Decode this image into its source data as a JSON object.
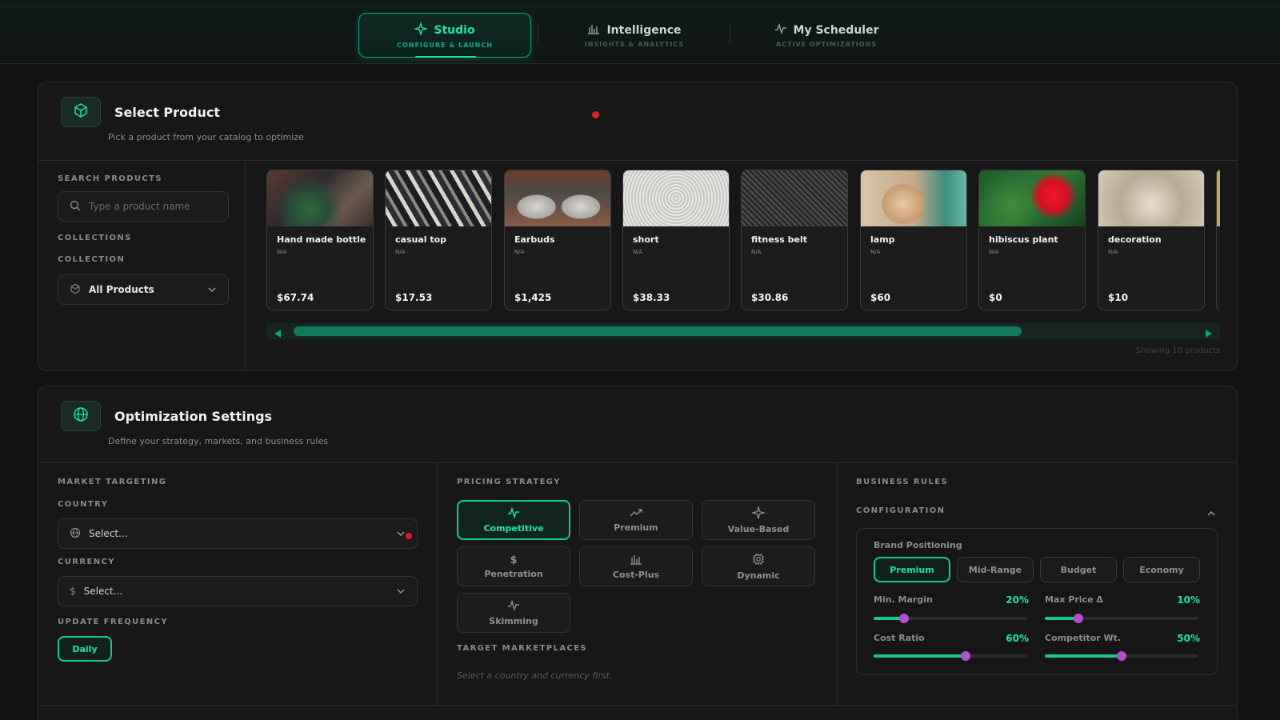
{
  "nav": {
    "tabs": [
      {
        "label": "Studio",
        "sub": "CONFIGURE & LAUNCH"
      },
      {
        "label": "Intelligence",
        "sub": "INSIGHTS & ANALYTICS"
      },
      {
        "label": "My Scheduler",
        "sub": "ACTIVE OPTIMIZATIONS"
      }
    ]
  },
  "select_product": {
    "title": "Select Product",
    "subtitle": "Pick a product from your catalog to optimize",
    "search_label": "SEARCH PRODUCTS",
    "search_placeholder": "Type a product name",
    "collections_label": "COLLECTIONS",
    "collection_label": "COLLECTION",
    "collection_value": "All Products",
    "products": [
      {
        "name": "Hand made bottle",
        "meta": "N/A",
        "price": "$67.74"
      },
      {
        "name": "casual top",
        "meta": "N/A",
        "price": "$17.53"
      },
      {
        "name": "Earbuds",
        "meta": "N/A",
        "price": "$1,425"
      },
      {
        "name": "short",
        "meta": "N/A",
        "price": "$38.33"
      },
      {
        "name": "fitness belt",
        "meta": "N/A",
        "price": "$30.86"
      },
      {
        "name": "lamp",
        "meta": "N/A",
        "price": "$60"
      },
      {
        "name": "hibiscus plant",
        "meta": "N/A",
        "price": "$0"
      },
      {
        "name": "decoration",
        "meta": "N/A",
        "price": "$10"
      }
    ],
    "showing": "Showing 10 products"
  },
  "optimization": {
    "title": "Optimization Settings",
    "subtitle": "Define your strategy, markets, and business rules",
    "market_label": "MARKET TARGETING",
    "country_label": "COUNTRY",
    "country_placeholder": "Select...",
    "currency_label": "CURRENCY",
    "currency_placeholder": "Select...",
    "frequency_label": "UPDATE FREQUENCY",
    "frequency_value": "Daily",
    "pricing_label": "PRICING STRATEGY",
    "strategies": [
      "Competitive",
      "Premium",
      "Value-Based",
      "Penetration",
      "Cost-Plus",
      "Dynamic",
      "Skimming"
    ],
    "marketplaces_label": "TARGET MARKETPLACES",
    "marketplaces_hint": "Select a country and currency first.",
    "business_label": "BUSINESS RULES",
    "config_label": "CONFIGURATION",
    "brand_label": "Brand Positioning",
    "brand_options": [
      "Premium",
      "Mid-Range",
      "Budget",
      "Economy"
    ],
    "sliders": [
      {
        "label": "Min. Margin",
        "value": "20%",
        "fraction": 0.2
      },
      {
        "label": "Max Price Δ",
        "value": "10%",
        "fraction": 0.22
      },
      {
        "label": "Cost Ratio",
        "value": "60%",
        "fraction": 0.6
      },
      {
        "label": "Competitor Wt.",
        "value": "50%",
        "fraction": 0.5
      }
    ]
  },
  "colors": {
    "accent": "#1fe3a5",
    "knob": "#b44fd0",
    "alert": "#e11d2a"
  }
}
